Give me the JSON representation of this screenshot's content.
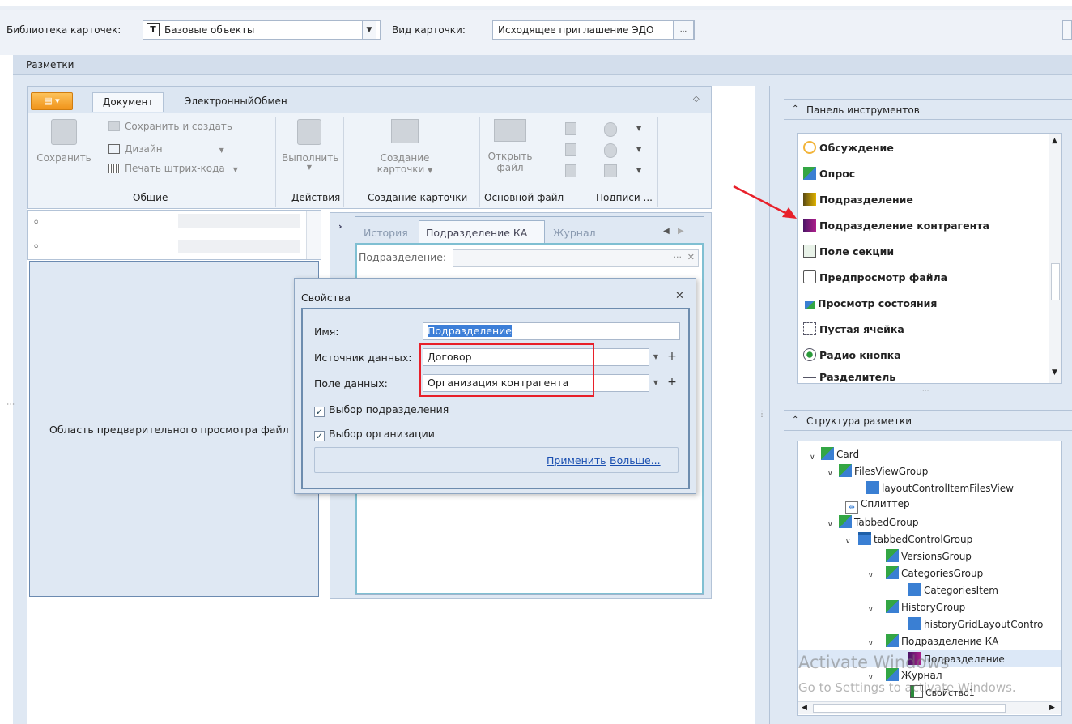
{
  "toolbar": {
    "library_label": "Библиотека карточек:",
    "library_value": "Базовые объекты",
    "view_label": "Вид карточки:",
    "view_value": "Исходящее приглашение ЭДО",
    "more_label": "..."
  },
  "layouts_title": "Разметки",
  "ribbon": {
    "tabs": [
      "Документ",
      "ЭлектронныйОбмен"
    ],
    "save": "Сохранить",
    "save_and_create": "Сохранить и создать",
    "design": "Дизайн",
    "print_barcode": "Печать штрих-кода",
    "execute": "Выполнить",
    "create_card_line1": "Создание",
    "create_card_line2": "карточки",
    "open_file_line1": "Открыть",
    "open_file_line2": "файл",
    "groups": [
      "Общие",
      "Действия",
      "Создание карточки",
      "Основной файл",
      "Подписи ..."
    ]
  },
  "preview_text": "Область предварительного просмотра файл",
  "card_tabs": [
    "История",
    "Подразделение КА",
    "Журнал"
  ],
  "card_field_label": "Подразделение:",
  "dialog": {
    "title": "Свойства",
    "name_label": "Имя:",
    "name_value": "Подразделение",
    "source_label": "Источник данных:",
    "source_value": "Договор",
    "field_label": "Поле данных:",
    "field_value": "Организация контрагента",
    "check1": "Выбор подразделения",
    "check2": "Выбор организации",
    "apply": "Применить",
    "more": "Больше..."
  },
  "toolpanel": {
    "title": "Панель инструментов",
    "items": [
      "Обсуждение",
      "Опрос",
      "Подразделение",
      "Подразделение контрагента",
      "Поле секции",
      "Предпросмотр файла",
      "Просмотр состояния",
      "Пустая ячейка",
      "Радио кнопка",
      "Разделитель"
    ]
  },
  "structure": {
    "title": "Структура разметки",
    "nodes": [
      "Card",
      "FilesViewGroup",
      "layoutControlItemFilesView",
      "Сплиттер",
      "TabbedGroup",
      "tabbedControlGroup",
      "VersionsGroup",
      "CategoriesGroup",
      "CategoriesItem",
      "HistoryGroup",
      "historyGridLayoutContro",
      "Подразделение КА",
      "Подразделение",
      "Журнал",
      "Свойство1"
    ]
  },
  "watermark": {
    "line1": "Activate Windows",
    "line2": "Go to Settings to activate Windows."
  },
  "colors": {
    "highlight_red": "#e8202a",
    "accent_orange": "#f5a623",
    "panel_bg": "#dfe8f3"
  }
}
